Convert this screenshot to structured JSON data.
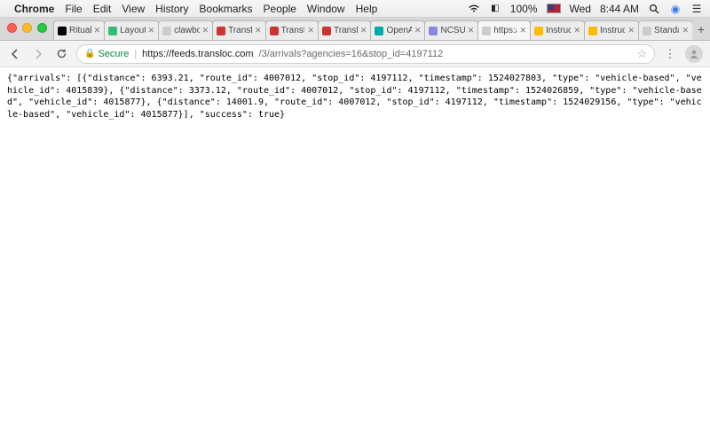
{
  "menubar": {
    "app": "Chrome",
    "items": [
      "File",
      "Edit",
      "View",
      "History",
      "Bookmarks",
      "People",
      "Window",
      "Help"
    ],
    "battery": "100%",
    "day": "Wed",
    "time": "8:44 AM"
  },
  "tabs": [
    {
      "title": "Ritual",
      "favicon": "#000"
    },
    {
      "title": "Layout",
      "favicon": "#3b7"
    },
    {
      "title": "clawbo",
      "favicon": "#ccc"
    },
    {
      "title": "Transf",
      "favicon": "#c33"
    },
    {
      "title": "Transf",
      "favicon": "#c33"
    },
    {
      "title": "Transf",
      "favicon": "#c33"
    },
    {
      "title": "OpenA",
      "favicon": "#0aa"
    },
    {
      "title": "NCSU",
      "favicon": "#88d"
    },
    {
      "title": "https:/",
      "favicon": "#ccc",
      "active": true
    },
    {
      "title": "Instruc",
      "favicon": "#fb0"
    },
    {
      "title": "Instruc",
      "favicon": "#fb0"
    },
    {
      "title": "Standa",
      "favicon": "#ccc"
    }
  ],
  "addressbar": {
    "secure_label": "Secure",
    "host": "https://feeds.transloc.com",
    "path": "/3/arrivals?agencies=16&stop_id=4197112"
  },
  "response": {
    "arrivals": [
      {
        "distance": 6393.21,
        "route_id": 4007012,
        "stop_id": 4197112,
        "timestamp": 1524027803,
        "type": "vehicle-based",
        "vehicle_id": 4015839
      },
      {
        "distance": 3373.12,
        "route_id": 4007012,
        "stop_id": 4197112,
        "timestamp": 1524026859,
        "type": "vehicle-based",
        "vehicle_id": 4015877
      },
      {
        "distance": 14001.9,
        "route_id": 4007012,
        "stop_id": 4197112,
        "timestamp": 1524029156,
        "type": "vehicle-based",
        "vehicle_id": 4015877
      }
    ],
    "success": true
  },
  "body_text": "{\"arrivals\": [{\"distance\": 6393.21, \"route_id\": 4007012, \"stop_id\": 4197112, \"timestamp\": 1524027803, \"type\": \"vehicle-based\", \"vehicle_id\": 4015839}, {\"distance\": 3373.12, \"route_id\": 4007012, \"stop_id\": 4197112, \"timestamp\": 1524026859, \"type\": \"vehicle-based\", \"vehicle_id\": 4015877}, {\"distance\": 14001.9, \"route_id\": 4007012, \"stop_id\": 4197112, \"timestamp\": 1524029156, \"type\": \"vehicle-based\", \"vehicle_id\": 4015877}], \"success\": true}"
}
